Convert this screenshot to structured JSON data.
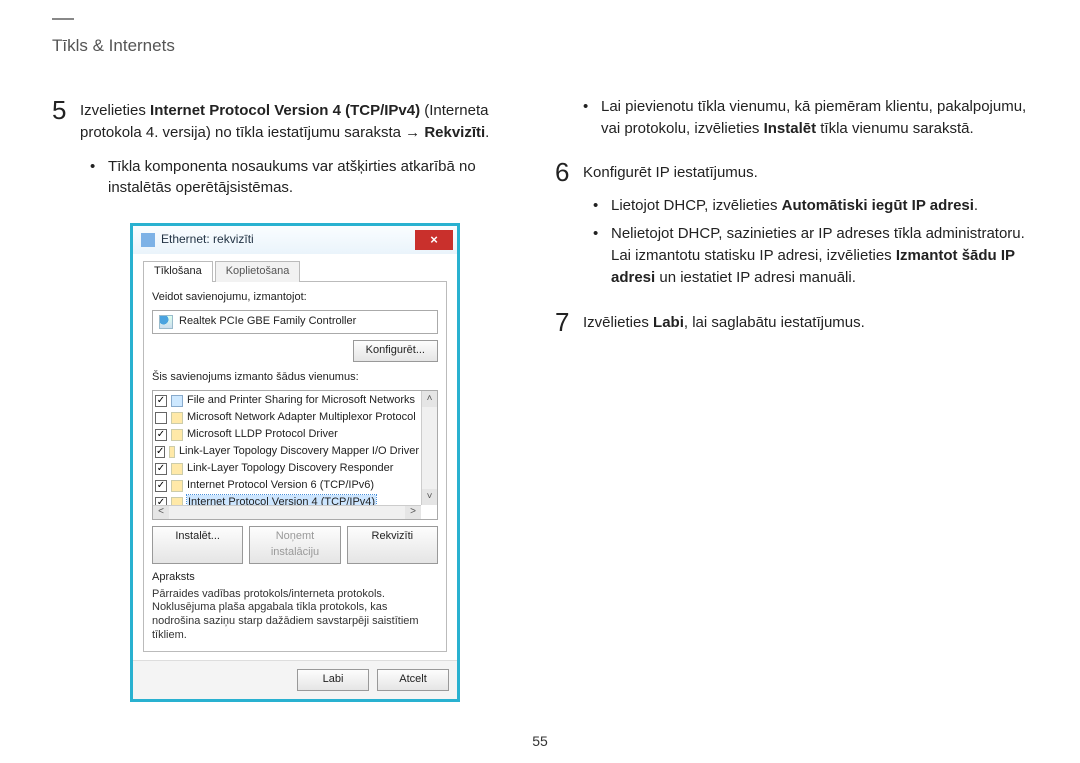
{
  "section_title": "Tīkls & Internets",
  "page_number": "55",
  "left": {
    "step5_num": "5",
    "step5_text_a": "Izvelieties ",
    "step5_bold1": "Internet Protocol Version 4 (TCP/IPv4)",
    "step5_text_b": " (Interneta protokola 4. versija) no tīkla iestatījumu saraksta → ",
    "step5_bold2": "Rekvizīti",
    "step5_text_c": ".",
    "step5_bullet1": "Tīkla komponenta nosaukums var atšķirties atkarībā no instalētās operētājsistēmas."
  },
  "right": {
    "top_bullet_a": "Lai pievienotu tīkla vienumu, kā piemēram klientu, pakalpojumu, vai protokolu, izvēlieties ",
    "top_bullet_bold": "Instalēt",
    "top_bullet_b": " tīkla vienumu sarakstā.",
    "step6_num": "6",
    "step6_text": "Konfigurēt IP iestatījumus.",
    "step6_b1_a": "Lietojot DHCP, izvēlieties ",
    "step6_b1_bold": "Automātiski iegūt IP adresi",
    "step6_b1_b": ".",
    "step6_b2_a": "Nelietojot DHCP, sazinieties ar IP adreses tīkla administratoru. Lai izmantotu statisku IP adresi, izvēlieties ",
    "step6_b2_bold": "Izmantot šādu IP adresi",
    "step6_b2_b": " un iestatiet IP adresi manuāli.",
    "step7_num": "7",
    "step7_a": "Izvēlieties ",
    "step7_bold": "Labi",
    "step7_b": ", lai saglabātu iestatījumus."
  },
  "dialog": {
    "title": "Ethernet: rekvizīti",
    "tab_active": "Tīklošana",
    "tab_inactive": "Koplietošana",
    "connect_label": "Veidot savienojumu, izmantojot:",
    "adapter": "Realtek PCIe GBE Family Controller",
    "configure_btn": "Konfigurēt...",
    "items_label": "Šis savienojums izmanto šādus vienumus:",
    "items": [
      {
        "checked": true,
        "icon": "net",
        "text": "File and Printer Sharing for Microsoft Networks",
        "selected": false
      },
      {
        "checked": false,
        "icon": "proto",
        "text": "Microsoft Network Adapter Multiplexor Protocol",
        "selected": false
      },
      {
        "checked": true,
        "icon": "proto",
        "text": "Microsoft LLDP Protocol Driver",
        "selected": false
      },
      {
        "checked": true,
        "icon": "proto",
        "text": "Link-Layer Topology Discovery Mapper I/O Driver",
        "selected": false
      },
      {
        "checked": true,
        "icon": "proto",
        "text": "Link-Layer Topology Discovery Responder",
        "selected": false
      },
      {
        "checked": true,
        "icon": "proto",
        "text": "Internet Protocol Version 6 (TCP/IPv6)",
        "selected": false
      },
      {
        "checked": true,
        "icon": "proto",
        "text": "Internet Protocol Version 4 (TCP/IPv4)",
        "selected": true
      }
    ],
    "install_btn": "Instalēt...",
    "uninstall_btn": "Noņemt instalāciju",
    "props_btn": "Rekvizīti",
    "desc_label": "Apraksts",
    "desc_text": "Pārraides vadības protokols/interneta protokols. Noklusējuma plaša apgabala tīkla protokols, kas nodrošina saziņu starp dažādiem savstarpēji saistītiem tīkliem.",
    "ok_btn": "Labi",
    "cancel_btn": "Atcelt"
  }
}
